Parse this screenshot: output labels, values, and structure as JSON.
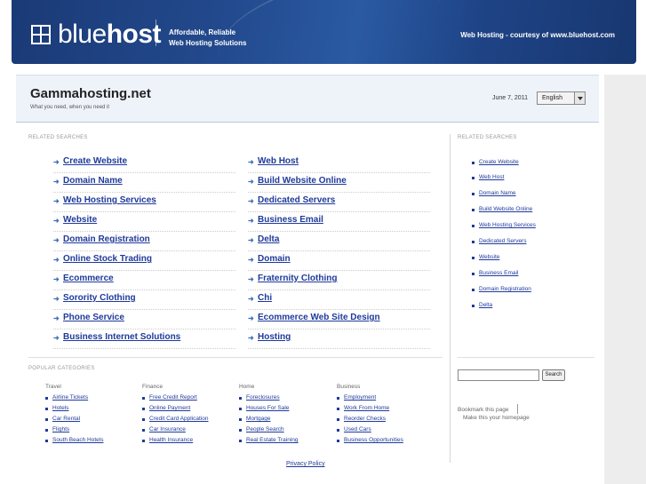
{
  "banner": {
    "logo_light": "blue",
    "logo_bold": "host",
    "tagline_line1": "Affordable, Reliable",
    "tagline_line2": "Web Hosting Solutions",
    "right_text": "Web Hosting - courtesy of www.bluehost.com",
    "colors": {
      "background": "#1c3d7a",
      "text": "#ffffff"
    }
  },
  "header": {
    "title": "Gammahosting.net",
    "subtitle": "What you need, when you need it",
    "date": "June 7, 2011",
    "language": "English"
  },
  "related_label": "RELATED SEARCHES",
  "related_left": [
    "Create Website",
    "Domain Name",
    "Web Hosting Services",
    "Website",
    "Domain Registration",
    "Online Stock Trading",
    "Ecommerce",
    "Sorority Clothing",
    "Phone Service",
    "Business Internet Solutions"
  ],
  "related_right_col": [
    "Web Host",
    "Build Website Online",
    "Dedicated Servers",
    "Business Email",
    "Delta",
    "Domain",
    "Fraternity Clothing",
    "Chi",
    "Ecommerce Web Site Design",
    "Hosting"
  ],
  "sidebar_label": "RELATED SEARCHES",
  "sidebar_related": [
    "Create Website",
    "Web Host",
    "Domain Name",
    "Build Website Online",
    "Web Hosting Services",
    "Dedicated Servers",
    "Website",
    "Business Email",
    "Domain Registration",
    "Delta"
  ],
  "popular_label": "POPULAR CATEGORIES",
  "categories": [
    {
      "heading": "Travel",
      "links": [
        "Airline Tickets",
        "Hotels",
        "Car Rental",
        "Flights",
        "South Beach Hotels"
      ]
    },
    {
      "heading": "Finance",
      "links": [
        "Free Credit Report",
        "Online Payment",
        "Credit Card Application",
        "Car Insurance",
        "Health Insurance"
      ]
    },
    {
      "heading": "Home",
      "links": [
        "Foreclosures",
        "Houses For Sale",
        "Mortgage",
        "People Search",
        "Real Estate Training"
      ]
    },
    {
      "heading": "Business",
      "links": [
        "Employment",
        "Work From Home",
        "Reorder Checks",
        "Used Cars",
        "Business Opportunities"
      ]
    }
  ],
  "search": {
    "value": "",
    "button": "Search"
  },
  "bookmark": "Bookmark this page",
  "homepage": "Make this your homepage",
  "footer": {
    "privacy": "Privacy Policy"
  },
  "colors": {
    "link": "#1f3a9a",
    "arrow": "#3d6fb8",
    "topbar": "#eef3fa"
  }
}
